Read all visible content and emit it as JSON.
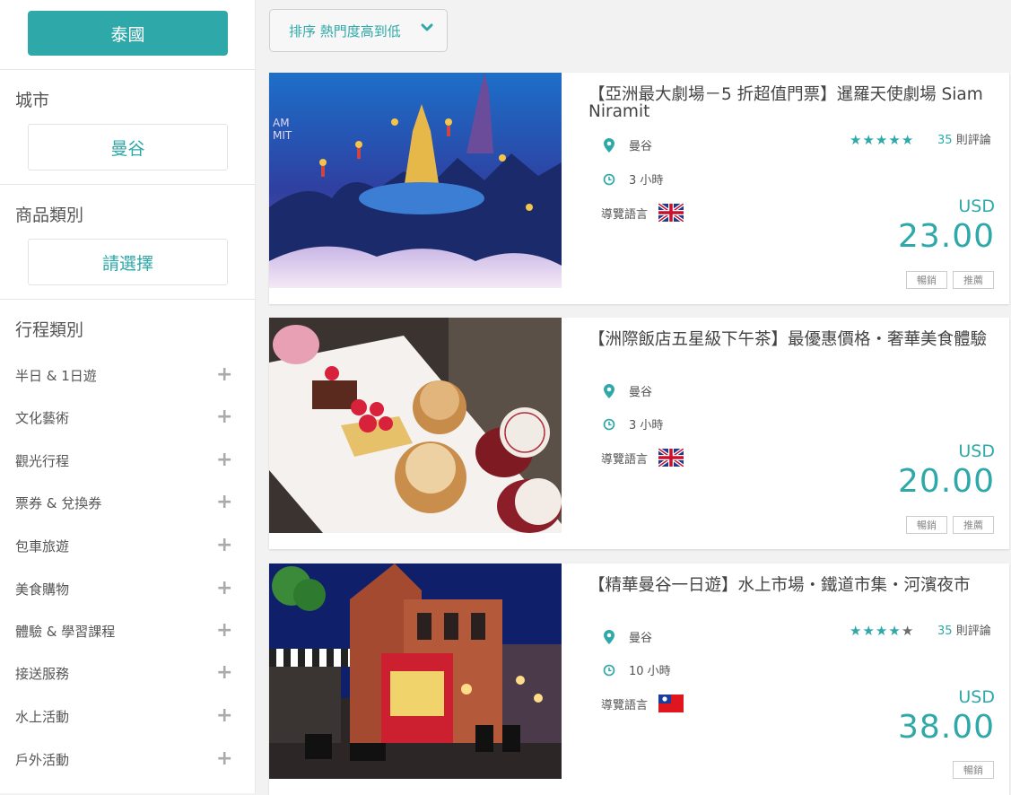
{
  "sidebar": {
    "country_label": "泰國",
    "city_title": "城市",
    "city_value": "曼谷",
    "product_title": "商品類別",
    "product_value": "請選擇",
    "itinerary_title": "行程類別",
    "categories": [
      {
        "label": "半日 & 1日遊"
      },
      {
        "label": "文化藝術"
      },
      {
        "label": "觀光行程"
      },
      {
        "label": "票券 & 兌換券"
      },
      {
        "label": "包車旅遊"
      },
      {
        "label": "美食購物"
      },
      {
        "label": "體驗 & 學習課程"
      },
      {
        "label": "接送服務"
      },
      {
        "label": "水上活動"
      },
      {
        "label": "戶外活動"
      }
    ]
  },
  "sort": {
    "label": "排序 熱門度高到低"
  },
  "products": [
    {
      "title": "【亞洲最大劇場－5 折超值門票】暹羅天使劇場 Siam Niramit",
      "location": "曼谷",
      "duration": "3 小時",
      "guide_label": "導覽語言",
      "flag": "uk-flag",
      "rating": 5,
      "review_count": "35",
      "review_suffix": "則評論",
      "currency": "USD",
      "price": "23.00",
      "tags": [
        "暢銷",
        "推薦"
      ]
    },
    {
      "title": "【洲際飯店五星級下午茶】最優惠價格・奢華美食體驗",
      "location": "曼谷",
      "duration": "3 小時",
      "guide_label": "導覽語言",
      "flag": "uk-flag",
      "currency": "USD",
      "price": "20.00",
      "tags": [
        "暢銷",
        "推薦"
      ]
    },
    {
      "title": "【精華曼谷一日遊】水上市場・鐵道市集・河濱夜市",
      "location": "曼谷",
      "duration": "10 小時",
      "guide_label": "導覽語言",
      "flag": "taiwan-flag",
      "rating": 4,
      "review_count": "35",
      "review_suffix": "則評論",
      "currency": "USD",
      "price": "38.00",
      "tags": [
        "暢銷"
      ]
    }
  ],
  "colors": {
    "accent": "#2ea8a8",
    "star_off": "#6c6c6c"
  }
}
